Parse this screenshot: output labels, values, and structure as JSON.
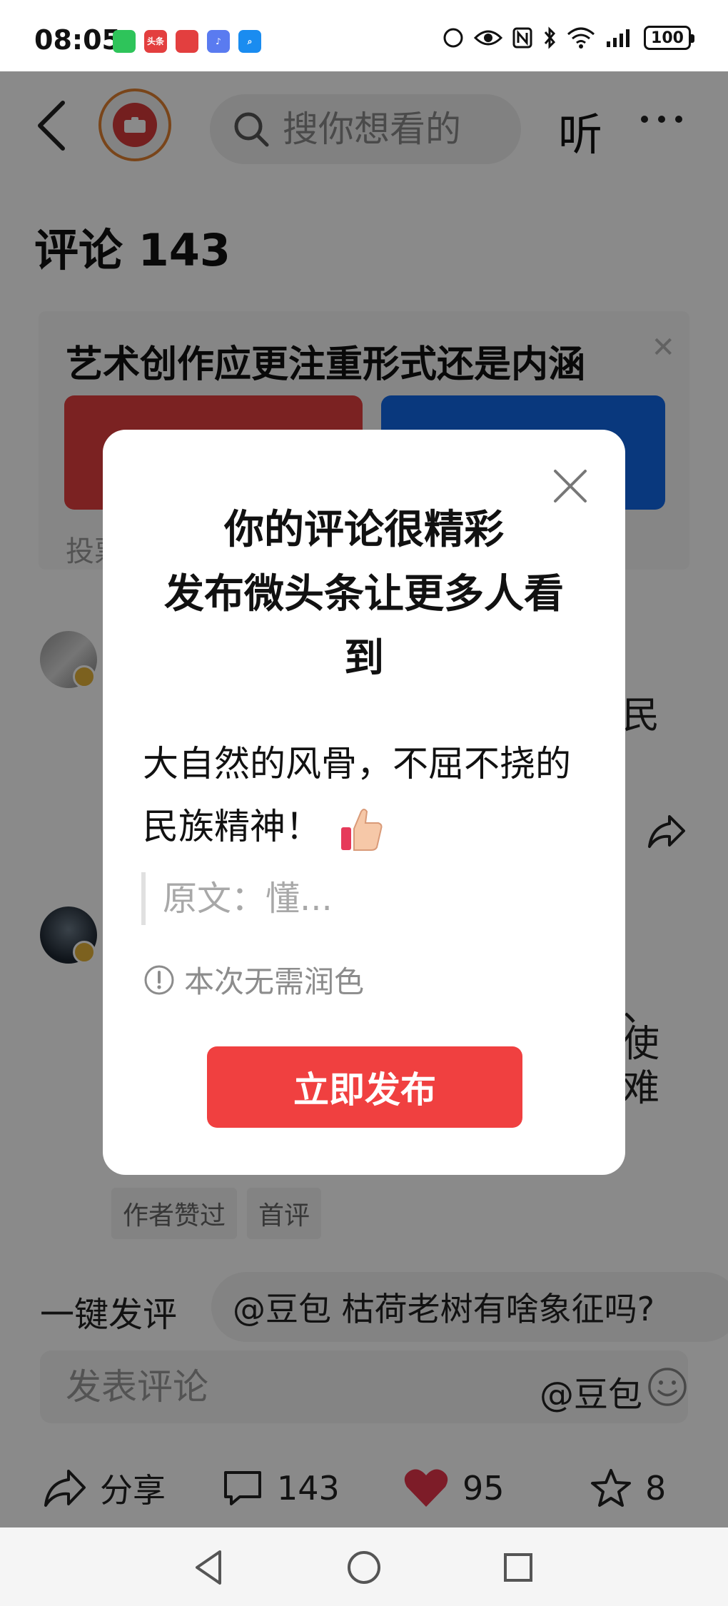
{
  "status_bar": {
    "time": "08:05",
    "battery": "100",
    "apps": [
      {
        "name": "wechat",
        "color": "#2ec45a",
        "label": ""
      },
      {
        "name": "toutiao",
        "color": "#e33f3f",
        "label": "头条"
      },
      {
        "name": "reader",
        "color": "#e33f3f",
        "label": ""
      },
      {
        "name": "music",
        "color": "#5a7bf0",
        "label": ""
      },
      {
        "name": "search",
        "color": "#1a8cf0",
        "label": ""
      }
    ]
  },
  "top_nav": {
    "search_placeholder": "搜你想看的",
    "listen_label": "听"
  },
  "comments_header": {
    "title": "评论 143"
  },
  "poll": {
    "question": "艺术创作应更注重形式还是内涵",
    "footer": "投票",
    "colors": {
      "left": "#e33f3f",
      "right": "#1268e8"
    }
  },
  "background_comments": {
    "c1_tail": "民",
    "c2_tail_1": "、",
    "c2_tail_2": "使",
    "c2_tail_3": "难"
  },
  "tags": [
    "作者赞过",
    "首评"
  ],
  "quick_reply": {
    "label": "一键发评",
    "suggestion": "@豆包 枯荷老树有啥象征吗?"
  },
  "comment_input": {
    "placeholder": "发表评论",
    "mention": "@豆包"
  },
  "action_bar": {
    "share_label": "分享",
    "comment_count": "143",
    "like_count": "95",
    "favorite_count": "8",
    "like_color": "#e8354a"
  },
  "modal": {
    "title_line1": "你的评论很精彩",
    "title_line2": "发布微头条让更多人看",
    "title_line3": "到",
    "comment_line1": "大自然的风骨，不屈不挠的",
    "comment_line2": "民族精神！",
    "quote": "原文：懂...",
    "hint": "本次无需润色",
    "publish_label": "立即发布",
    "publish_color": "#f04040"
  }
}
